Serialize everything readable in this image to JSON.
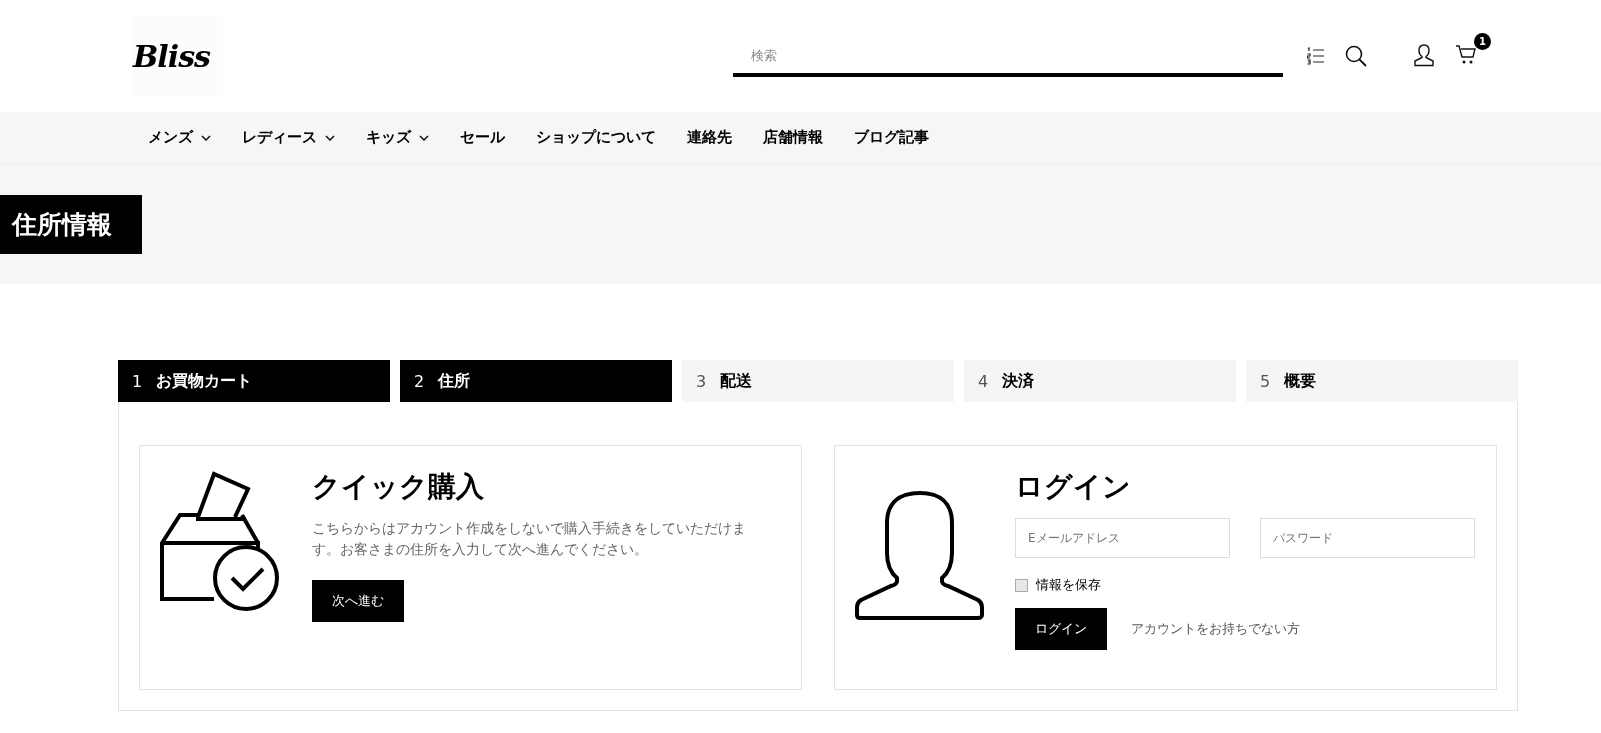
{
  "header": {
    "logo": "Bliss",
    "search": {
      "placeholder": "検索"
    },
    "cart_count": "1"
  },
  "nav": [
    {
      "label": "メンズ",
      "dropdown": true
    },
    {
      "label": "レディース",
      "dropdown": true
    },
    {
      "label": "キッズ",
      "dropdown": true
    },
    {
      "label": "セール",
      "dropdown": false
    },
    {
      "label": "ショップについて",
      "dropdown": false
    },
    {
      "label": "連絡先",
      "dropdown": false
    },
    {
      "label": "店舗情報",
      "dropdown": false
    },
    {
      "label": "ブログ記事",
      "dropdown": false
    }
  ],
  "page_title": "住所情報",
  "steps": [
    {
      "number": "1",
      "label": "お買物カート",
      "active": true
    },
    {
      "number": "2",
      "label": "住所",
      "active": true
    },
    {
      "number": "3",
      "label": "配送",
      "active": false
    },
    {
      "number": "4",
      "label": "決済",
      "active": false
    },
    {
      "number": "5",
      "label": "概要",
      "active": false
    }
  ],
  "quick_purchase": {
    "title": "クイック購入",
    "text": "こちらからはアカウント作成をしないで購入手続きをしていただけます。お客さまの住所を入力して次へ進んでください。",
    "button": "次へ進む"
  },
  "login": {
    "title": "ログイン",
    "email": {
      "placeholder": "Eメールアドレス"
    },
    "password": {
      "placeholder": "パスワード"
    },
    "remember": {
      "label": "情報を保存",
      "checked": false
    },
    "button": "ログイン",
    "register_link": "アカウントをお持ちでない方"
  }
}
